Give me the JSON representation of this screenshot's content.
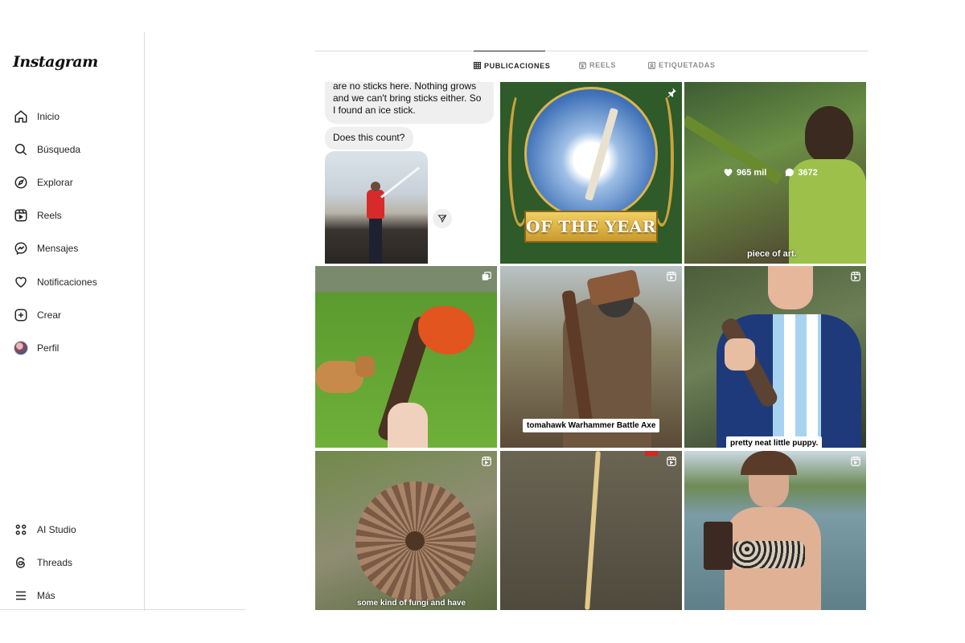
{
  "app": {
    "logo": "Instagram"
  },
  "sidebar": {
    "items": [
      {
        "label": "Inicio",
        "icon": "home-icon"
      },
      {
        "label": "Búsqueda",
        "icon": "search-icon"
      },
      {
        "label": "Explorar",
        "icon": "compass-icon"
      },
      {
        "label": "Reels",
        "icon": "reels-icon"
      },
      {
        "label": "Mensajes",
        "icon": "messenger-icon"
      },
      {
        "label": "Notificaciones",
        "icon": "heart-icon"
      },
      {
        "label": "Crear",
        "icon": "plus-square-icon"
      },
      {
        "label": "Perfil",
        "icon": "avatar"
      }
    ],
    "bottom_items": [
      {
        "label": "AI Studio",
        "icon": "ai-studio-icon"
      },
      {
        "label": "Threads",
        "icon": "threads-icon"
      },
      {
        "label": "Más",
        "icon": "menu-icon"
      }
    ]
  },
  "tabs": [
    {
      "label": "PUBLICACIONES",
      "icon": "grid-icon",
      "active": true
    },
    {
      "label": "REELS",
      "icon": "reels-icon",
      "active": false
    },
    {
      "label": "ETIQUETADAS",
      "icon": "tagged-icon",
      "active": false
    }
  ],
  "posts": [
    {
      "chat_text": "are no sticks here. Nothing grows and we can't bring sticks either. So I found an ice stick.",
      "chat_reply": "Does this count?",
      "badge": ""
    },
    {
      "banner": "OF THE YEAR",
      "badge": "pin-icon"
    },
    {
      "likes": "965 mil",
      "comments": "3672",
      "caption": "piece of art.",
      "badge": ""
    },
    {
      "caption": "",
      "badge": "carousel-icon"
    },
    {
      "caption": "tomahawk Warhammer Battle Axe",
      "badge": "reels-icon"
    },
    {
      "caption": "pretty neat little puppy.",
      "badge": "reels-icon"
    },
    {
      "caption": "some kind of fungi and have",
      "badge": "reels-icon"
    },
    {
      "caption": "",
      "badge": "reels-icon"
    },
    {
      "caption": "",
      "badge": "reels-icon"
    }
  ],
  "colors": {
    "text": "#262626",
    "muted": "#8e8e8e",
    "border": "#dbdbdb",
    "active_tab": "#262626"
  }
}
